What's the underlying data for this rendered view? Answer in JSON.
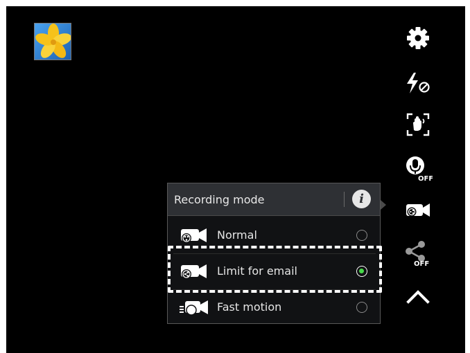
{
  "panel": {
    "title": "Recording mode",
    "options": [
      {
        "label": "Normal",
        "selected": false,
        "icon": "camcorder-normal-icon"
      },
      {
        "label": "Limit for email",
        "selected": true,
        "icon": "camcorder-share-icon"
      },
      {
        "label": "Fast motion",
        "selected": false,
        "icon": "camcorder-fast-icon"
      }
    ]
  },
  "sidebar": {
    "icons": [
      "settings-gear-icon",
      "flash-off-icon",
      "gesture-icon",
      "voice-control-off-icon",
      "recording-mode-icon",
      "share-off-icon",
      "collapse-chevron-up-icon"
    ]
  },
  "colors": {
    "background": "#000000",
    "panel_header": "#2e3034",
    "selected_radio": "#47d94a",
    "highlight_outline": "#ffffff"
  }
}
